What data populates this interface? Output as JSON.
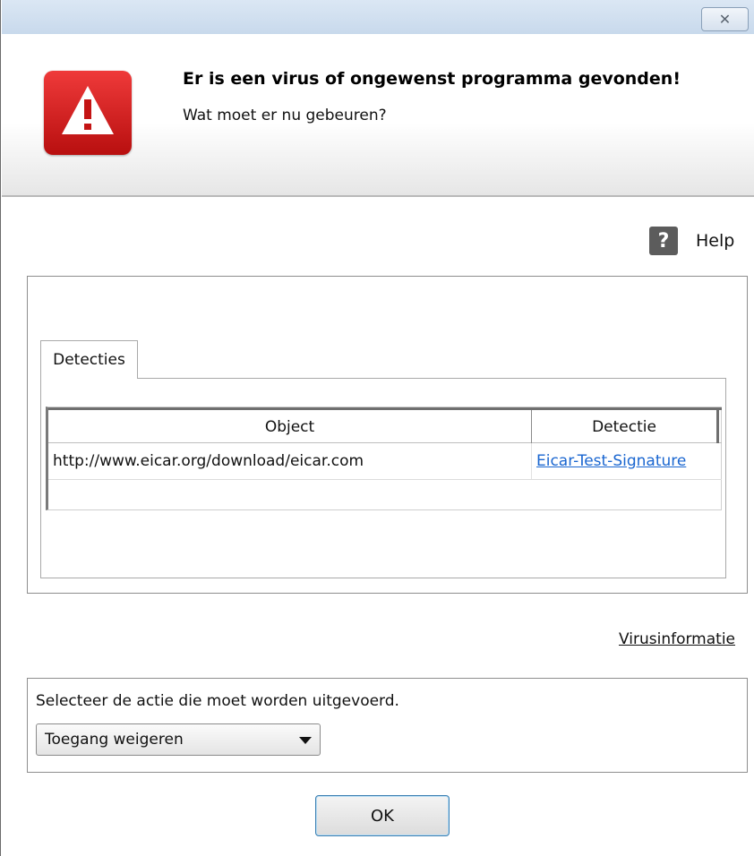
{
  "window": {
    "close_glyph": "✕"
  },
  "header": {
    "icon": "warning-triangle-icon",
    "icon_glyph": "!",
    "title": "Er is een virus of ongewenst programma gevonden!",
    "subtitle": "Wat moet er nu gebeuren?"
  },
  "help": {
    "icon_glyph": "?",
    "label": "Help"
  },
  "tabs": [
    {
      "label": "Detecties"
    }
  ],
  "table": {
    "columns": [
      "Object",
      "Detectie"
    ],
    "rows": [
      {
        "object": "http://www.eicar.org/download/eicar.com",
        "detection": "Eicar-Test-Signature"
      }
    ]
  },
  "virus_info_link": "Virusinformatie",
  "action": {
    "label": "Selecteer de actie die moet worden uitgevoerd.",
    "selected": "Toegang weigeren"
  },
  "ok_button": {
    "label": "OK"
  },
  "colors": {
    "warning_red": "#d42222",
    "link_blue": "#1a66d0"
  }
}
